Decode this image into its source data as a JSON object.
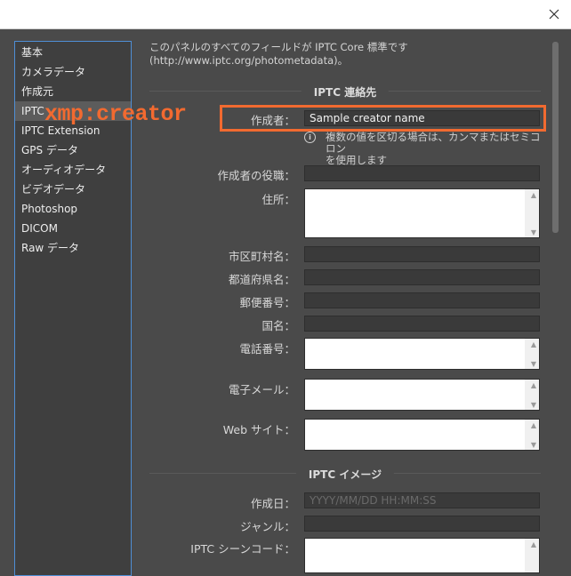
{
  "window": {
    "close_icon": "close-icon"
  },
  "sidebar": {
    "items": [
      {
        "label": "基本"
      },
      {
        "label": "カメラデータ"
      },
      {
        "label": "作成元"
      },
      {
        "label": "IPTC"
      },
      {
        "label": "IPTC Extension"
      },
      {
        "label": "GPS データ"
      },
      {
        "label": "オーディオデータ"
      },
      {
        "label": "ビデオデータ"
      },
      {
        "label": "Photoshop"
      },
      {
        "label": "DICOM"
      },
      {
        "label": "Raw データ"
      }
    ],
    "active_index": 3
  },
  "intro": {
    "line1": "このパネルのすべてのフィールドが IPTC Core 標準です",
    "line2": "(http://www.iptc.org/photometadata)。"
  },
  "contact_section": {
    "title": "IPTC 連絡先",
    "creator_label": "作成者：",
    "creator_value": "Sample creator name",
    "hint_line1": "複数の値を区切る場合は、カンマまたはセミコロン",
    "hint_line2": "を使用します",
    "creator_job_label": "作成者の役職：",
    "address_label": "住所：",
    "city_label": "市区町村名：",
    "state_label": "都道府県名：",
    "postal_label": "郵便番号：",
    "country_label": "国名：",
    "phone_label": "電話番号：",
    "email_label": "電子メール：",
    "website_label": "Web サイト："
  },
  "image_section": {
    "title": "IPTC イメージ",
    "date_label": "作成日：",
    "date_placeholder": "YYYY/MM/DD HH:MM:SS",
    "genre_label": "ジャンル：",
    "scene_label": "IPTC シーンコード："
  },
  "annotation": {
    "label": "xmp:creator",
    "color": "#f26a30"
  }
}
